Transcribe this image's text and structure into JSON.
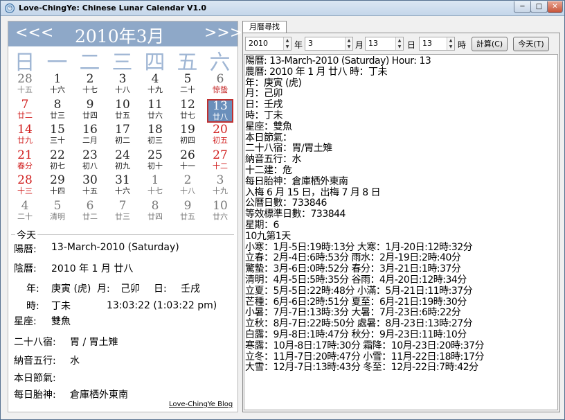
{
  "window": {
    "title": "Love-ChingYe: Chinese Lunar Calendar V1.0",
    "minimize": "−",
    "maximize": "□",
    "close": "✕",
    "app_icon": "clock-icon"
  },
  "calendar": {
    "prev": "<<<",
    "month_title": "2010年3月",
    "next": ">>>",
    "weekdays": [
      "日",
      "一",
      "二",
      "三",
      "四",
      "五",
      "六"
    ],
    "rows": [
      [
        {
          "d": "28",
          "l": "十五",
          "t": "grey"
        },
        {
          "d": "1",
          "l": "十六",
          "t": "cur"
        },
        {
          "d": "2",
          "l": "十七",
          "t": "cur"
        },
        {
          "d": "3",
          "l": "十八",
          "t": "cur"
        },
        {
          "d": "4",
          "l": "十九",
          "t": "cur"
        },
        {
          "d": "5",
          "l": "二十",
          "t": "cur"
        },
        {
          "d": "6",
          "l": "惊蛰",
          "t": "festival"
        }
      ],
      [
        {
          "d": "7",
          "l": "廿二",
          "t": "red"
        },
        {
          "d": "8",
          "l": "廿三",
          "t": "cur"
        },
        {
          "d": "9",
          "l": "廿四",
          "t": "cur"
        },
        {
          "d": "10",
          "l": "廿五",
          "t": "cur"
        },
        {
          "d": "11",
          "l": "廿六",
          "t": "cur"
        },
        {
          "d": "12",
          "l": "廿七",
          "t": "cur"
        },
        {
          "d": "13",
          "l": "廿八",
          "t": "sel"
        }
      ],
      [
        {
          "d": "14",
          "l": "廿九",
          "t": "red"
        },
        {
          "d": "15",
          "l": "三十",
          "t": "cur"
        },
        {
          "d": "16",
          "l": "二月",
          "t": "cur"
        },
        {
          "d": "17",
          "l": "初二",
          "t": "cur"
        },
        {
          "d": "18",
          "l": "初三",
          "t": "cur"
        },
        {
          "d": "19",
          "l": "初四",
          "t": "cur"
        },
        {
          "d": "20",
          "l": "初五",
          "t": "red"
        }
      ],
      [
        {
          "d": "21",
          "l": "春分",
          "t": "red"
        },
        {
          "d": "22",
          "l": "初七",
          "t": "cur"
        },
        {
          "d": "23",
          "l": "初八",
          "t": "cur"
        },
        {
          "d": "24",
          "l": "初九",
          "t": "cur"
        },
        {
          "d": "25",
          "l": "初十",
          "t": "cur"
        },
        {
          "d": "26",
          "l": "十一",
          "t": "cur"
        },
        {
          "d": "27",
          "l": "十二",
          "t": "red"
        }
      ],
      [
        {
          "d": "28",
          "l": "十三",
          "t": "red"
        },
        {
          "d": "29",
          "l": "十四",
          "t": "cur"
        },
        {
          "d": "30",
          "l": "十五",
          "t": "cur"
        },
        {
          "d": "31",
          "l": "十六",
          "t": "cur"
        },
        {
          "d": "1",
          "l": "十七",
          "t": "grey"
        },
        {
          "d": "2",
          "l": "十八",
          "t": "grey"
        },
        {
          "d": "3",
          "l": "十九",
          "t": "grey"
        }
      ],
      [
        {
          "d": "4",
          "l": "二十",
          "t": "grey"
        },
        {
          "d": "5",
          "l": "清明",
          "t": "grey"
        },
        {
          "d": "6",
          "l": "廿二",
          "t": "grey"
        },
        {
          "d": "7",
          "l": "廿三",
          "t": "grey"
        },
        {
          "d": "8",
          "l": "廿四",
          "t": "grey"
        },
        {
          "d": "9",
          "l": "廿五",
          "t": "grey"
        },
        {
          "d": "10",
          "l": "廿六",
          "t": "grey"
        }
      ]
    ]
  },
  "today": {
    "label": "今天",
    "solar_label": "陽曆:",
    "solar_value": "13-March-2010 (Saturday)",
    "lunar_label": "陰曆:",
    "lunar_value": "2010 年 1 月 廿八",
    "year_label": "年:",
    "year_value": "庚寅 (虎)",
    "month_label": "月:",
    "month_value": "己卯",
    "day_label": "日:",
    "day_value": "壬戌",
    "hour_label": "時:",
    "hour_value": "丁未",
    "time_value": "13:03:22 (1:03:22 pm)",
    "zodiac_label": "星座:",
    "zodiac_value": "雙魚",
    "mansion_label": "二十八宿:",
    "mansion_value": "胃 / 胃土雉",
    "nayin_label": "納音五行:",
    "nayin_value": "水",
    "festival_label": "本日節氣:",
    "fetal_label": "每日胎神:",
    "fetal_value": "倉庫栖外東南",
    "blog_link": "Love-ChingYe Blog"
  },
  "search": {
    "tab_label": "月曆尋找",
    "year_value": "2010",
    "year_unit": "年",
    "month_value": "3",
    "month_unit": "月",
    "day_value": "13",
    "day_unit": "日",
    "hour_value": "13",
    "hour_unit": "時",
    "calc_button": "計算(C)",
    "today_button": "今天(T)",
    "output_lines": [
      "陽曆: 13-March-2010 (Saturday) Hour: 13",
      "農曆: 2010 年 1 月 廿八  時：丁未",
      "年：庚寅 (虎)",
      "月：己卯",
      "日：壬戌",
      "時：丁未",
      "星座：雙魚",
      "本日節氣：",
      "二十八宿：胃/胃土雉",
      "納音五行：水",
      "十二建：危",
      "每日胎神：倉庫栖外東南",
      "入梅 6 月 15 日，出梅 7 月 8 日",
      "公曆日數：733846",
      "等效標準日數：733844",
      "星期：6",
      "10九第1天",
      "小寒：1月-5日:19時:13分    大寒：1月-20日:12時:32分",
      "立春：2月-4日:6時:53分     雨水：2月-19日:2時:40分",
      "驚蟄：3月-6日:0時:52分     春分：3月-21日:1時:37分",
      "清明：4月-5日:5時:35分     谷雨：4月-20日:12時:34分",
      "立夏：5月-5日:22時:48分    小滿：5月-21日:11時:37分",
      "芒種：6月-6日:2時:51分     夏至：6月-21日:19時:30分",
      "小暑：7月-7日:13時:3分     大暑：7月-23日:6時:22分",
      "立秋：8月-7日:22時:50分    處暑：8月-23日:13時:27分",
      "白露：9月-8日:1時:47分     秋分：9月-23日:11時:10分",
      "寒露：10月-8日:17時:30分   霜降：10月-23日:20時:37分",
      "立冬：11月-7日:20時:47分   小雪：11月-22日:18時:17分",
      "大雪：12月-7日:13時:43分   冬至：12月-22日:7時:42分"
    ]
  }
}
